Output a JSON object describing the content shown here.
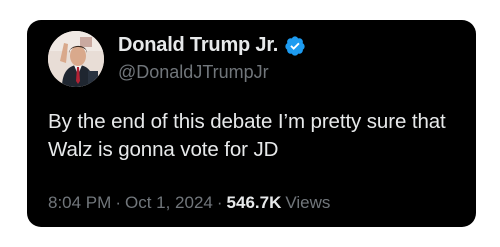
{
  "tweet": {
    "author": {
      "name": "Donald Trump Jr.",
      "handle": "@DonaldJTrumpJr",
      "verified_icon": "verified-badge-icon",
      "avatar": "profile-photo"
    },
    "text": "By the end of this debate I’m pretty sure that Walz is gonna vote for JD",
    "meta": {
      "time": "8:04 PM",
      "separator": "·",
      "date": "Oct 1, 2024",
      "views_count": "546.7K",
      "views_label": "Views"
    }
  },
  "colors": {
    "background": "#000000",
    "primary_text": "#e7e9ea",
    "secondary_text": "#71767b",
    "verified_blue": "#1d9bf0"
  }
}
